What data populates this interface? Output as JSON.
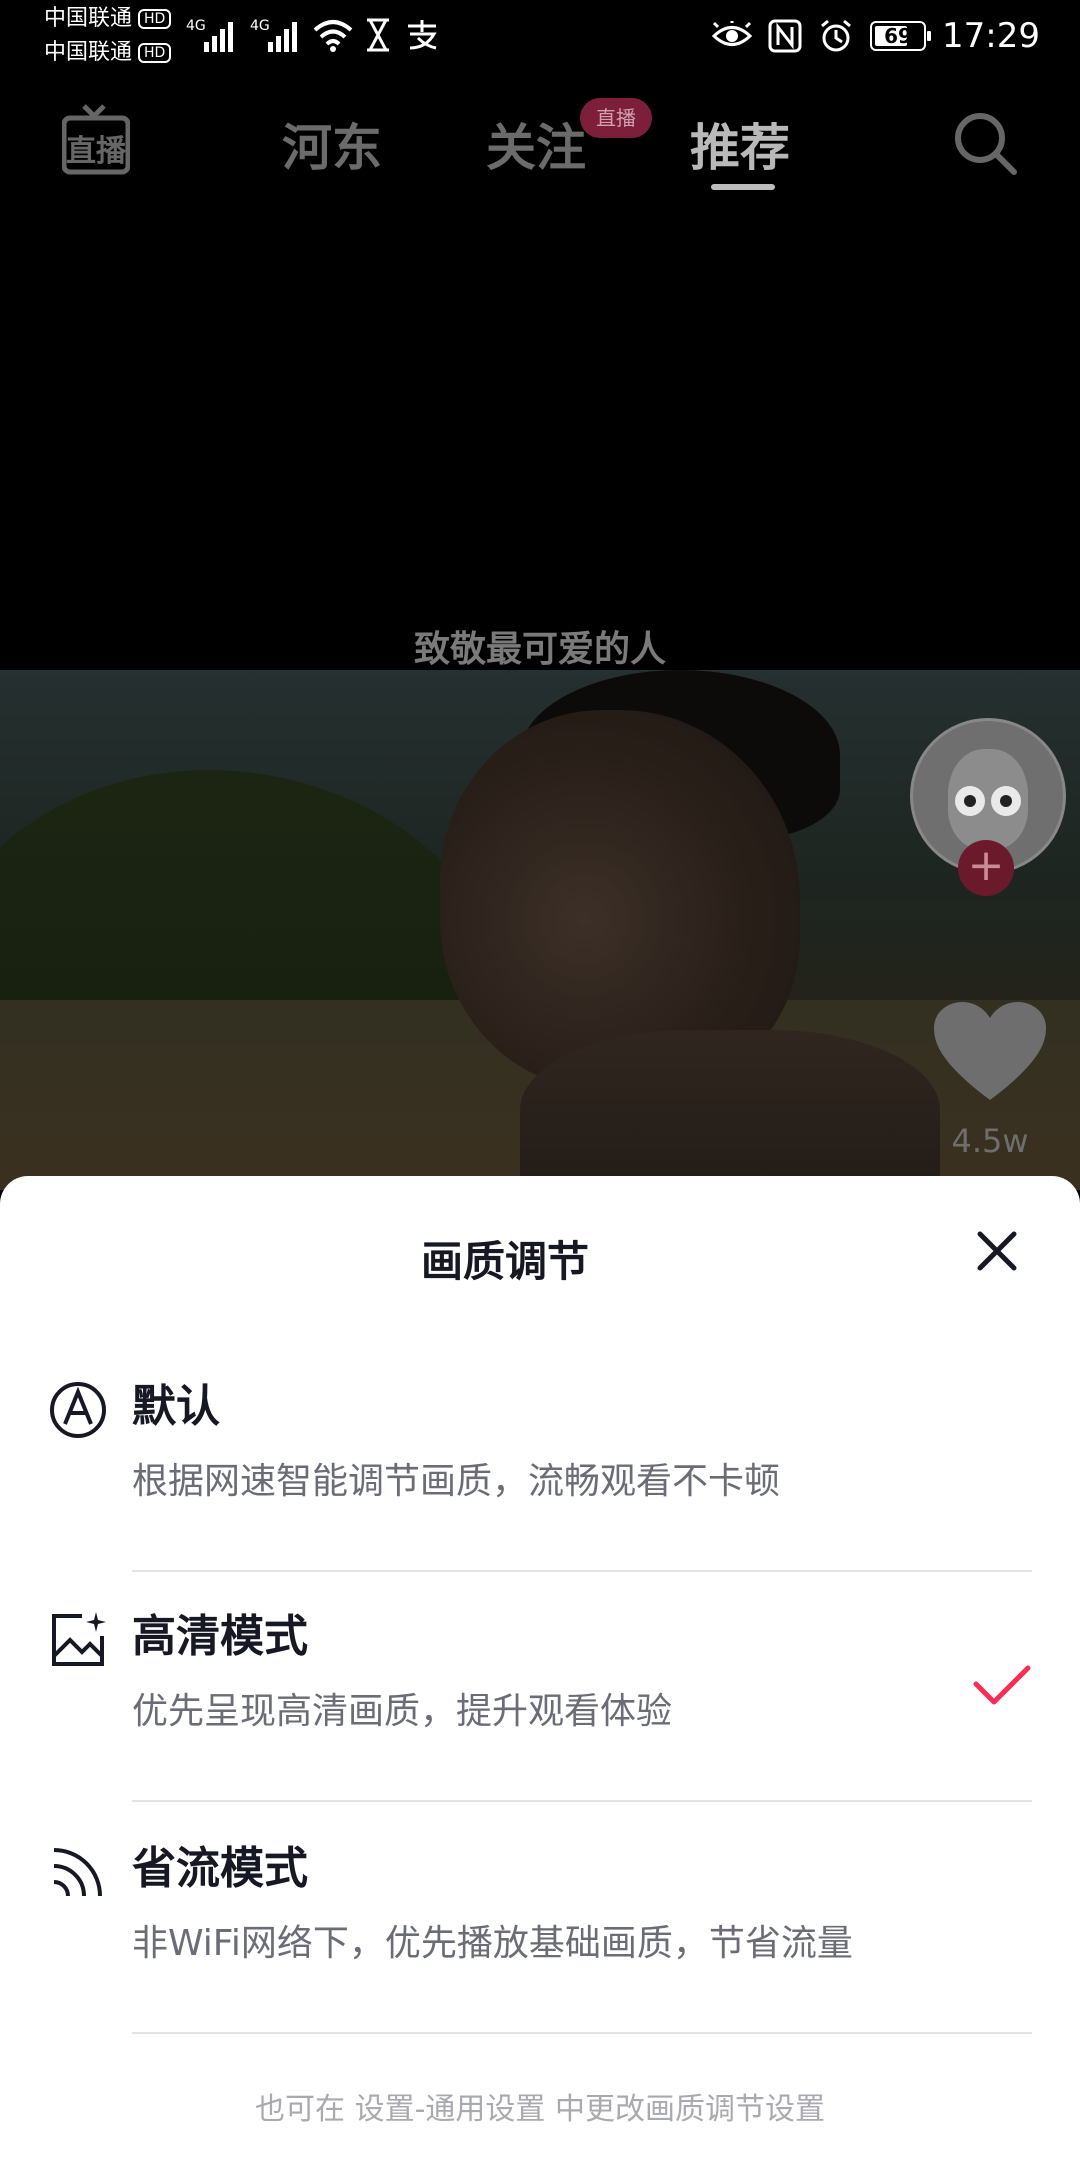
{
  "status_bar": {
    "carrier1": "中国联通",
    "carrier2": "中国联通",
    "hd_label": "HD",
    "network1": "4G",
    "network2": "4G",
    "battery": "69",
    "time": "17:29"
  },
  "top_nav": {
    "tabs": [
      {
        "label": "河东"
      },
      {
        "label": "关注"
      },
      {
        "label": "推荐"
      }
    ],
    "live_icon_label": "直播",
    "live_badge": "直播",
    "active_tab": "推荐",
    "icons": [
      "live-tv-icon",
      "search-icon"
    ]
  },
  "video": {
    "caption": "致敬最可爱的人",
    "like_count": "4.5w",
    "follow_label": "+"
  },
  "sheet": {
    "title": "画质调节",
    "options": [
      {
        "title": "默认",
        "desc": "根据网速智能调节画质，流畅观看不卡顿",
        "icon": "auto-a-icon",
        "selected": false
      },
      {
        "title": "高清模式",
        "desc": "优先呈现高清画质，提升观看体验",
        "icon": "hd-image-icon",
        "selected": true
      },
      {
        "title": "省流模式",
        "desc": "非WiFi网络下，优先播放基础画质，节省流量",
        "icon": "data-saver-icon",
        "selected": false
      }
    ],
    "footer": "也可在 设置-通用设置 中更改画质调节设置",
    "accent_color": "#fe2c55"
  }
}
